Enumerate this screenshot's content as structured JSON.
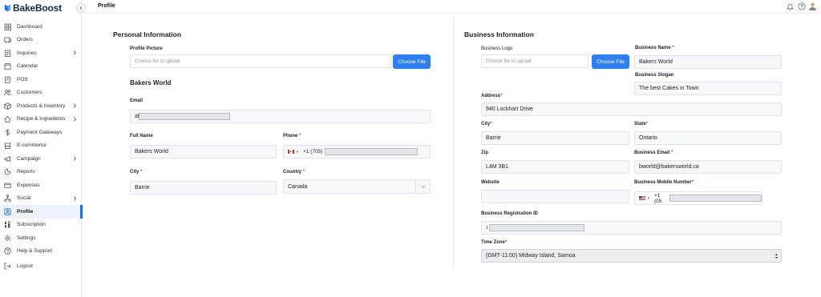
{
  "brand": {
    "name": "BakeBoost"
  },
  "sidebar": {
    "items": [
      {
        "label": "Dashboard",
        "icon": "dashboard-icon",
        "chevron": false
      },
      {
        "label": "Orders",
        "icon": "orders-icon",
        "chevron": false
      },
      {
        "label": "Inquiries",
        "icon": "inquiries-icon",
        "chevron": true
      },
      {
        "label": "Calendar",
        "icon": "calendar-icon",
        "chevron": false
      },
      {
        "label": "POS",
        "icon": "pos-icon",
        "chevron": false
      },
      {
        "label": "Customers",
        "icon": "customers-icon",
        "chevron": false
      },
      {
        "label": "Products & Inventory",
        "icon": "products-icon",
        "chevron": true
      },
      {
        "label": "Recipe & Ingredients",
        "icon": "recipe-icon",
        "chevron": true
      },
      {
        "label": "Payment Gateways",
        "icon": "dollar-icon",
        "chevron": false
      },
      {
        "label": "E-commerce",
        "icon": "ecommerce-icon",
        "chevron": false
      },
      {
        "label": "Campaign",
        "icon": "megaphone-icon",
        "chevron": true
      },
      {
        "label": "Reports",
        "icon": "reports-icon",
        "chevron": false
      },
      {
        "label": "Expenses",
        "icon": "expenses-icon",
        "chevron": false
      },
      {
        "label": "Social",
        "icon": "social-icon",
        "chevron": true
      },
      {
        "label": "Profile",
        "icon": "profile-icon",
        "chevron": false,
        "active": true
      },
      {
        "label": "Subscription",
        "icon": "subscription-icon",
        "chevron": false
      },
      {
        "label": "Settings",
        "icon": "settings-icon",
        "chevron": false
      },
      {
        "label": "Help & Support",
        "icon": "help-icon",
        "chevron": false
      },
      {
        "label": "Logout",
        "icon": "logout-icon",
        "chevron": false
      }
    ]
  },
  "header": {
    "title": "Profile"
  },
  "personal": {
    "title": "Personal Information",
    "profile_picture_label": "Profile Picture",
    "file_placeholder": "Choose file to upload",
    "choose_file": "Choose File",
    "business_name": "Bakers World",
    "email_label": "Email",
    "email_value": "al",
    "full_name_label": "Full Name",
    "full_name_value": "Bakers World",
    "phone_label": "Phone",
    "phone_code": "+1 (705)",
    "city_label": "City",
    "city_value": "Barrie",
    "country_label": "Country",
    "country_value": "Canada"
  },
  "business": {
    "title": "Business Information",
    "logo_label": "Business Logo",
    "file_placeholder": "Choose file to upload",
    "choose_file": "Choose File",
    "name_label": "Business Name",
    "name_value": "Bakers World",
    "slogan_label": "Business Slogan",
    "slogan_value": "The best Cakes in Town",
    "address_label": "Address",
    "address_value": "940 Lockhart Drive",
    "city_label": "City",
    "city_value": "Barrie",
    "state_label": "State",
    "state_value": "Ontario",
    "zip_label": "Zip",
    "zip_value": "L4M 3B1",
    "email_label": "Business Email",
    "email_value": "bworld@bakersworld.ca",
    "website_label": "Website",
    "website_value": "",
    "mobile_label": "Business Mobile Number",
    "mobile_code": "+1 (05",
    "reg_label": "Business Registration ID",
    "reg_value": "1",
    "tz_label": "Time Zone",
    "tz_value": "(GMT-11:00) Midway Island, Samoa"
  },
  "colors": {
    "accent": "#2f7ff0",
    "required": "#e0405a",
    "active_bar": "#1e6fe0"
  }
}
